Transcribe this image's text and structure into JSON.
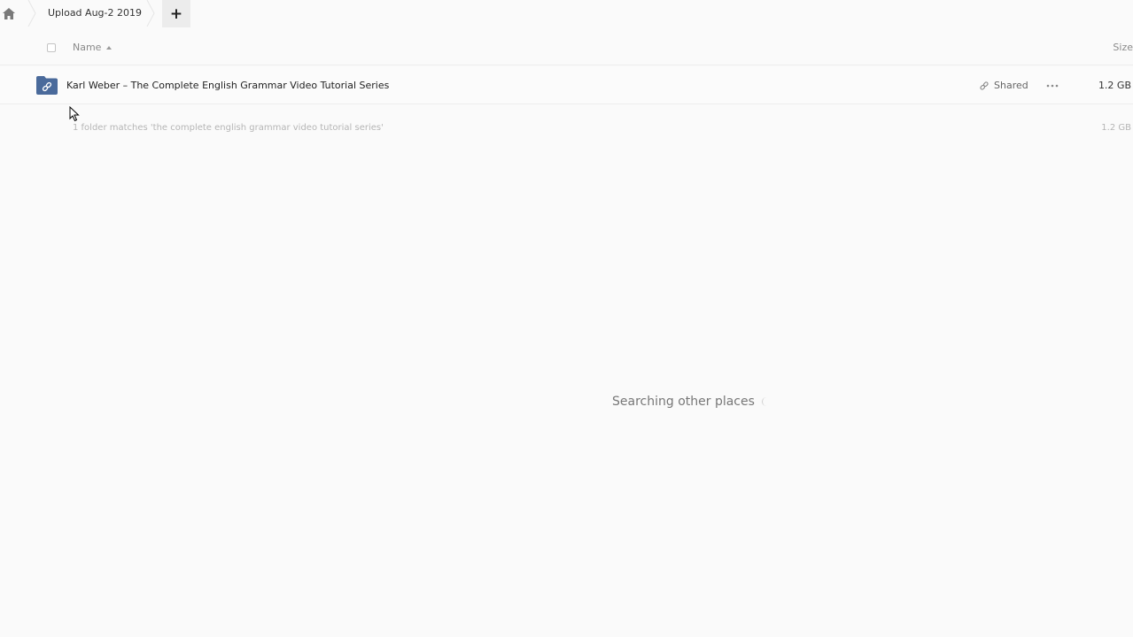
{
  "breadcrumb": {
    "home_icon": "home-icon",
    "current_folder": "Upload Aug-2 2019",
    "add_label": "+"
  },
  "columns": {
    "name_label": "Name",
    "size_label": "Size"
  },
  "files": [
    {
      "name": "Karl Weber – The Complete English Grammar Video Tutorial Series",
      "icon": "shared-folder-icon",
      "shared_label": "Shared",
      "size": "1.2 GB"
    }
  ],
  "summary": {
    "text": "1 folder matches 'the complete english grammar video tutorial series'",
    "size": "1.2 GB"
  },
  "status": {
    "searching_text": "Searching other places"
  },
  "colors": {
    "folder_blue": "#4a6a9b",
    "background": "#fafafa"
  }
}
